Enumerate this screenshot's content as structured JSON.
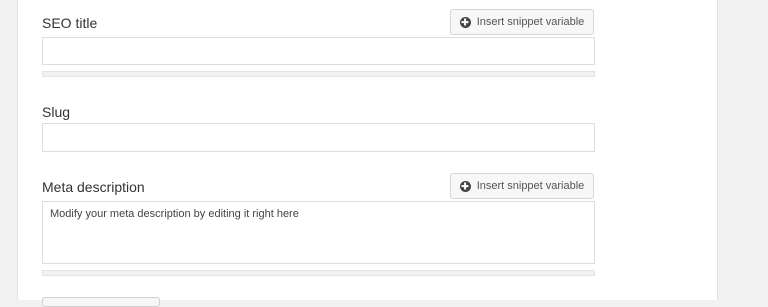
{
  "seo_title": {
    "label": "SEO title",
    "snippet_button": "Insert snippet variable",
    "value": "",
    "progress": 0
  },
  "slug": {
    "label": "Slug",
    "value": ""
  },
  "meta_description": {
    "label": "Meta description",
    "snippet_button": "Insert snippet variable",
    "value": "Modify your meta description by editing it right here",
    "progress": 0
  },
  "icons": {
    "snippet": "plus-circle-icon"
  }
}
